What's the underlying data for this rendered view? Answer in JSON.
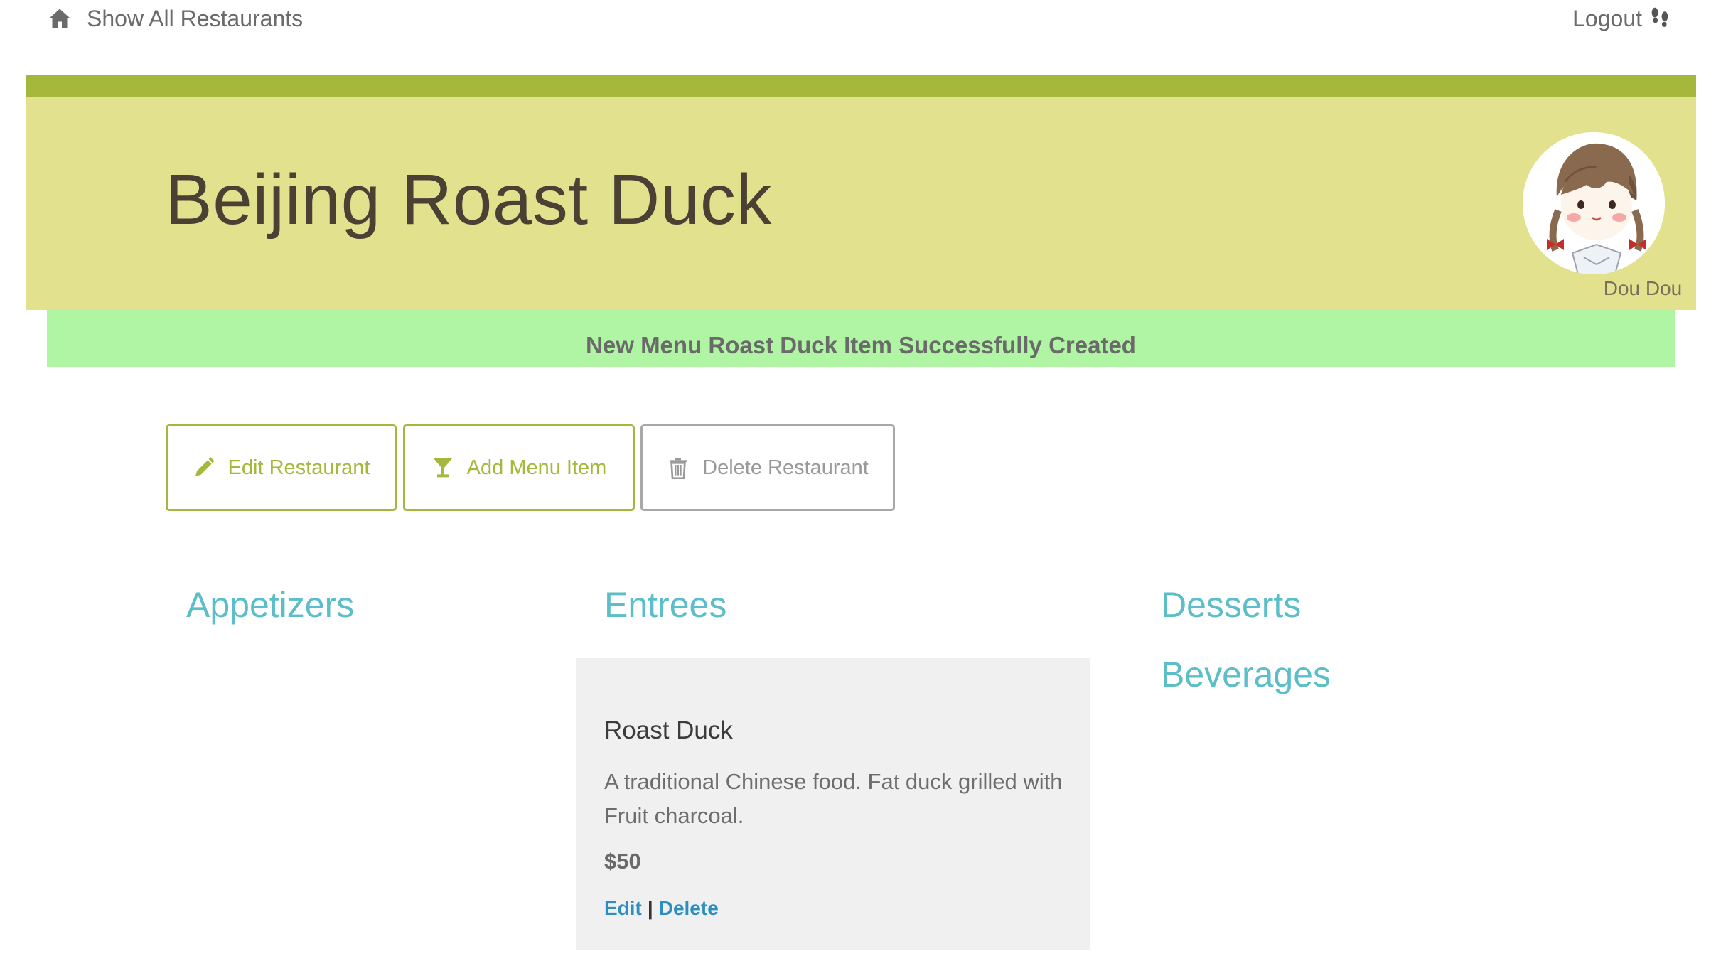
{
  "nav": {
    "home_label": "Show All Restaurants",
    "logout_label": "Logout"
  },
  "header": {
    "title": "Beijing Roast Duck",
    "username": "Dou Dou"
  },
  "flash": {
    "message": "New Menu Roast Duck Item Successfully Created"
  },
  "actions": {
    "edit_label": "Edit Restaurant",
    "add_label": "Add Menu Item",
    "delete_label": "Delete Restaurant"
  },
  "menu": {
    "appetizers": "Appetizers",
    "entrees": "Entrees",
    "desserts": "Desserts",
    "beverages": "Beverages",
    "item": {
      "name": "Roast Duck",
      "description": "A traditional Chinese food. Fat duck grilled with Fruit charcoal.",
      "price": "$50",
      "edit_label": "Edit",
      "separator": "|",
      "delete_label": "Delete"
    }
  },
  "colors": {
    "accent": "#a5b83c",
    "header_bg": "#e1e18e",
    "flash_bg": "#b0f5a4",
    "heading": "#5bbec8",
    "link": "#2d8fc1"
  },
  "icons": {
    "home": "home-icon",
    "logout": "footprints-icon",
    "edit": "pencil-icon",
    "add": "cocktail-glass-icon",
    "delete": "trash-icon"
  }
}
